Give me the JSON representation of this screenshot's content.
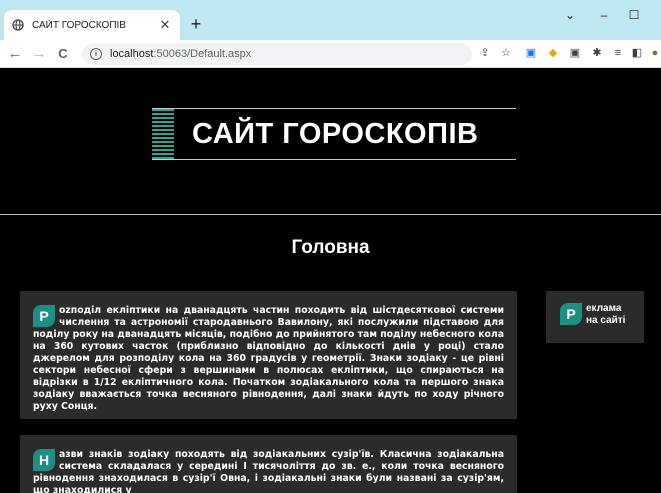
{
  "browser": {
    "tab_title": "САЙТ ГОРОСКОПІВ",
    "url_host": "localhost",
    "url_path": ":50063/Default.aspx",
    "new_tab": "+",
    "back": "←",
    "forward": "→",
    "reload": "C"
  },
  "page": {
    "site_title": "САЙТ ГОРОСКОПІВ",
    "heading": "Головна",
    "articles": [
      {
        "initial": "Р",
        "text": "оzподіл екліптики на дванадцять частин походить від шістдесяткової системи числення та астрономії стародавнього Вавилону, які послужили підставою для поділу року на дванадцять місяців, подібно до прийнятого там поділу небесного кола на 360 кутових часток (приблизно відповідно до кількості днів у році) стало джерелом для розподілу кола на 360 градусів у геометрії. Знаки зодіаку - це рівні сектори небесної сфери з вершинами в полюсах екліптики, що спираються на відрізки в 1/12 екліптичного кола. Початком зодіакального кола та першого знака зодіаку вважається точка весняного рівнодення, далі знаки йдуть по ходу річного руху Сонця."
      },
      {
        "initial": "Н",
        "text": "азви знаків зодіаку походять від зодіакальних сузір'їв. Класична зодіакальна система складалася у середині І тисячоліття до зв. е., коли точка весняного рівнодення знаходилася в сузір'ї Овна, і зодіакальні знаки були названі за сузір'ям, що знаходилися у"
      }
    ],
    "sidebar": {
      "initial": "Р",
      "line1": "еклама",
      "line2": "на сайті"
    }
  }
}
